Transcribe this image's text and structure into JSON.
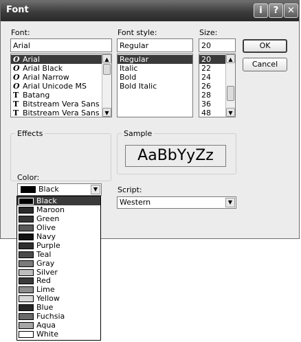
{
  "window": {
    "title": "Font"
  },
  "titlebar_buttons": {
    "info": "i",
    "help": "?",
    "close": "✕"
  },
  "font": {
    "label": "Font:",
    "value": "Arial",
    "items": [
      {
        "name": "Arial",
        "icon": "opentype-icon",
        "glyph": "O"
      },
      {
        "name": "Arial Black",
        "icon": "opentype-icon",
        "glyph": "O"
      },
      {
        "name": "Arial Narrow",
        "icon": "opentype-icon",
        "glyph": "O"
      },
      {
        "name": "Arial Unicode MS",
        "icon": "opentype-icon",
        "glyph": "O"
      },
      {
        "name": "Batang",
        "icon": "truetype-icon",
        "glyph": "T"
      },
      {
        "name": "Bitstream Vera Sans",
        "icon": "truetype-icon",
        "glyph": "T"
      },
      {
        "name": "Bitstream Vera Sans M",
        "icon": "truetype-icon",
        "glyph": "T"
      }
    ],
    "selected_index": 0
  },
  "style": {
    "label": "Font style:",
    "value": "Regular",
    "items": [
      "Regular",
      "Italic",
      "Bold",
      "Bold Italic"
    ],
    "selected_index": 0
  },
  "size": {
    "label": "Size:",
    "value": "20",
    "items": [
      "20",
      "22",
      "24",
      "26",
      "28",
      "36",
      "48"
    ],
    "selected_index": 0
  },
  "buttons": {
    "ok": "OK",
    "cancel": "Cancel"
  },
  "effects": {
    "title": "Effects"
  },
  "sample": {
    "title": "Sample",
    "text": "AaBbYyZz"
  },
  "color": {
    "label": "Color:",
    "value": "Black",
    "value_swatch": "#000000",
    "options": [
      {
        "name": "Black",
        "swatch": "#000000"
      },
      {
        "name": "Maroon",
        "swatch": "#2a2a2a"
      },
      {
        "name": "Green",
        "swatch": "#353535"
      },
      {
        "name": "Olive",
        "swatch": "#595959"
      },
      {
        "name": "Navy",
        "swatch": "#121212"
      },
      {
        "name": "Purple",
        "swatch": "#2f2f2f"
      },
      {
        "name": "Teal",
        "swatch": "#4a4a4a"
      },
      {
        "name": "Gray",
        "swatch": "#7a7a7a"
      },
      {
        "name": "Silver",
        "swatch": "#bdbdbd"
      },
      {
        "name": "Red",
        "swatch": "#3a3a3a"
      },
      {
        "name": "Lime",
        "swatch": "#8c8c8c"
      },
      {
        "name": "Yellow",
        "swatch": "#d8d8d8"
      },
      {
        "name": "Blue",
        "swatch": "#262626"
      },
      {
        "name": "Fuchsia",
        "swatch": "#6a6a6a"
      },
      {
        "name": "Aqua",
        "swatch": "#a6a6a6"
      },
      {
        "name": "White",
        "swatch": "#ffffff"
      }
    ],
    "selected_index": 0
  },
  "script": {
    "label": "Script:",
    "value": "Western"
  },
  "colors": {
    "titlebar": "#3c3c3c",
    "selection": "#3a3a3a",
    "dialog_bg": "#ececec"
  }
}
